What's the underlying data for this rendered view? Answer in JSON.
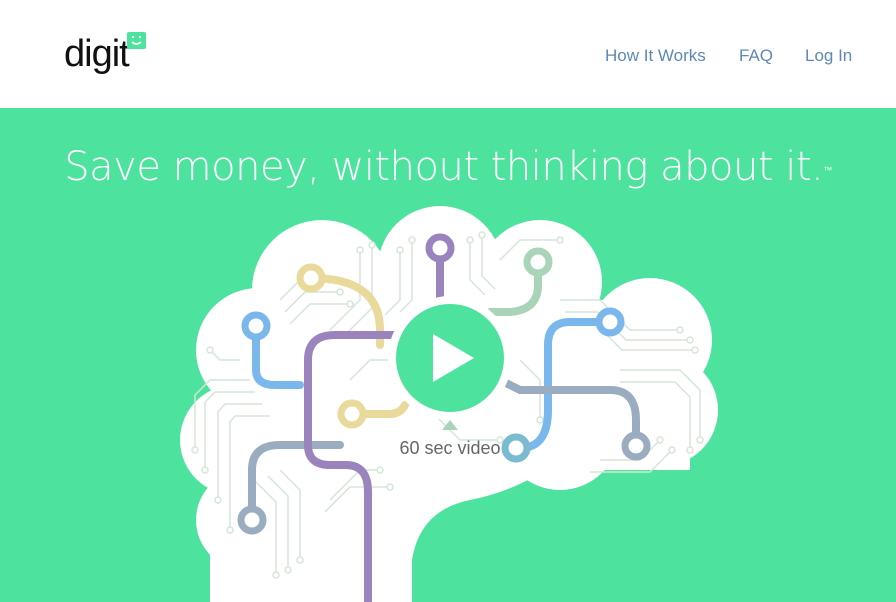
{
  "header": {
    "logo_text": "digit",
    "nav": [
      {
        "label": "How It Works"
      },
      {
        "label": "FAQ"
      },
      {
        "label": "Log In"
      }
    ]
  },
  "hero": {
    "headline": "Save money, without thinking about it.",
    "trademark": "™",
    "video_caption": "60 sec video"
  },
  "colors": {
    "brand_green": "#4de29e",
    "nav_link": "#5e89b7",
    "purple": "#9b84bd",
    "yellow": "#e9d99a",
    "blue": "#7ab7ec",
    "sage": "#a9d4b7",
    "slate": "#9aacbf",
    "teal": "#79bcd2"
  }
}
